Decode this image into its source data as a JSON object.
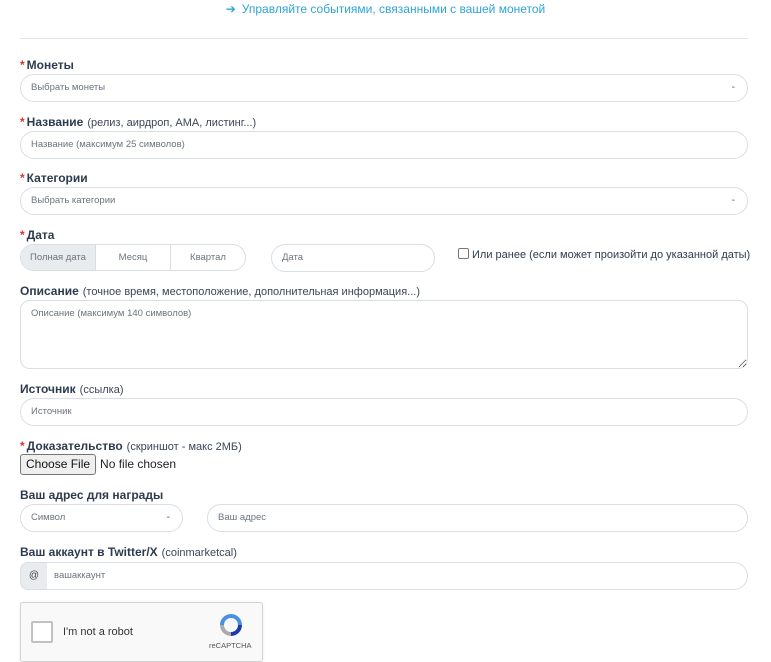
{
  "header": {
    "manage_link": "Управляйте событиями, связанными с вашей монетой",
    "arrow_icon": "arrow-right-icon"
  },
  "form": {
    "coins": {
      "label": "Монеты",
      "required_mark": "*",
      "placeholder": "Выбрать монеты"
    },
    "title": {
      "label": "Название",
      "required_mark": "*",
      "hint": "(релиз, аирдроп, AMA, листинг...)",
      "placeholder": "Название (максимум 25 символов)"
    },
    "categories": {
      "label": "Категории",
      "required_mark": "*",
      "placeholder": "Выбрать категории"
    },
    "date": {
      "label": "Дата",
      "required_mark": "*",
      "options": [
        "Полная дата",
        "Месяц",
        "Квартал"
      ],
      "selected": "Полная дата",
      "placeholder": "Дата",
      "or_earlier_label": "Или ранее (если может произойти до указанной даты)",
      "or_earlier_checked": false
    },
    "description": {
      "label": "Описание",
      "hint": "(точное время, местоположение, дополнительная информация...)",
      "placeholder": "Описание (максимум 140 символов)"
    },
    "source": {
      "label": "Источник",
      "hint": "(ссылка)",
      "placeholder": "Источник"
    },
    "proof": {
      "label": "Доказательство",
      "required_mark": "*",
      "hint": "(скриншот - макс 2МБ)",
      "button_label": "Choose File",
      "status": "No file chosen"
    },
    "reward": {
      "label": "Ваш адрес для награды",
      "symbol_placeholder": "Символ",
      "address_placeholder": "Ваш адрес"
    },
    "twitter": {
      "label": "Ваш аккаунт в Twitter/X",
      "hint": "(coinmarketcal)",
      "prefix": "@",
      "placeholder": "вашаккаунт"
    },
    "captcha": {
      "label": "I'm not a robot",
      "brand": "reCAPTCHA"
    }
  },
  "colors": {
    "accent": "#2ea3d8",
    "required": "#d9342b",
    "label": "#2d3b4e",
    "border": "#d9dee4"
  }
}
